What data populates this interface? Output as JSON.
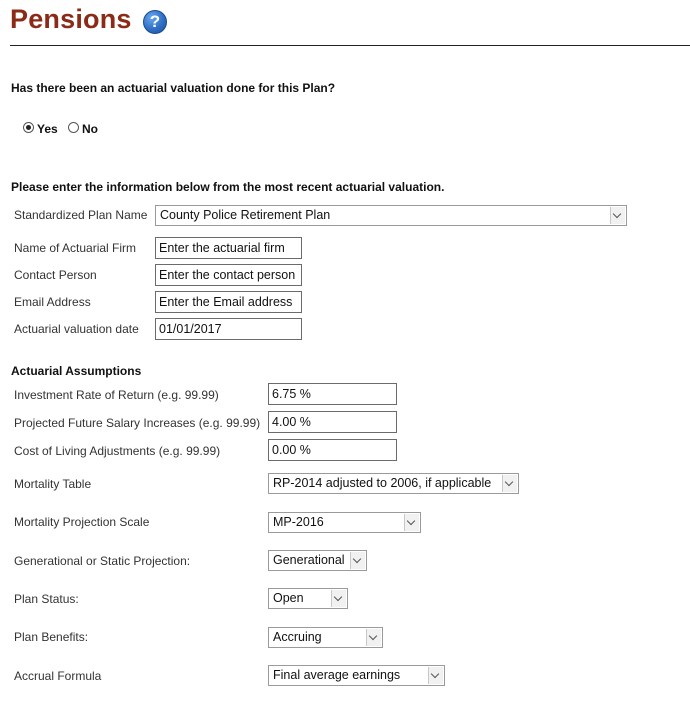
{
  "header": {
    "title": "Pensions",
    "help_glyph": "?"
  },
  "valuation_question": {
    "label": "Has there been an actuarial valuation done for this Plan?",
    "options": [
      {
        "label": "Yes",
        "checked": true
      },
      {
        "label": "No",
        "checked": false
      }
    ]
  },
  "instructions": "Please enter the information below from the most recent actuarial valuation.",
  "plan_info": {
    "plan_name": {
      "label": "Standardized Plan Name",
      "value": "County Police Retirement Plan"
    },
    "firm": {
      "label": "Name of Actuarial Firm",
      "placeholder": "Enter the actuarial firm"
    },
    "contact": {
      "label": "Contact Person",
      "placeholder": "Enter the contact person"
    },
    "email": {
      "label": "Email Address",
      "placeholder": "Enter the Email address"
    },
    "valuation_date": {
      "label": "Actuarial valuation date",
      "value": "01/01/2017"
    }
  },
  "assumptions": {
    "heading": "Actuarial Assumptions",
    "investment_return": {
      "label": "Investment Rate of Return (e.g. 99.99)",
      "value": "6.75 %"
    },
    "salary_increases": {
      "label": "Projected Future Salary Increases (e.g. 99.99)",
      "value": "4.00 %"
    },
    "cola": {
      "label": "Cost of Living Adjustments (e.g. 99.99)",
      "value": "0.00 %"
    },
    "mortality_table": {
      "label": "Mortality Table",
      "value": "RP-2014 adjusted to 2006, if applicable"
    },
    "projection_scale": {
      "label": "Mortality Projection Scale",
      "value": "MP-2016"
    },
    "projection_type": {
      "label": "Generational or Static Projection:",
      "value": "Generational"
    },
    "plan_status": {
      "label": "Plan Status:",
      "value": "Open"
    },
    "plan_benefits": {
      "label": "Plan Benefits:",
      "value": "Accruing"
    },
    "accrual_formula": {
      "label": "Accrual Formula",
      "value": "Final average earnings"
    }
  },
  "colors": {
    "title": "#8b2a17",
    "help_icon": "#2f6fc6"
  }
}
